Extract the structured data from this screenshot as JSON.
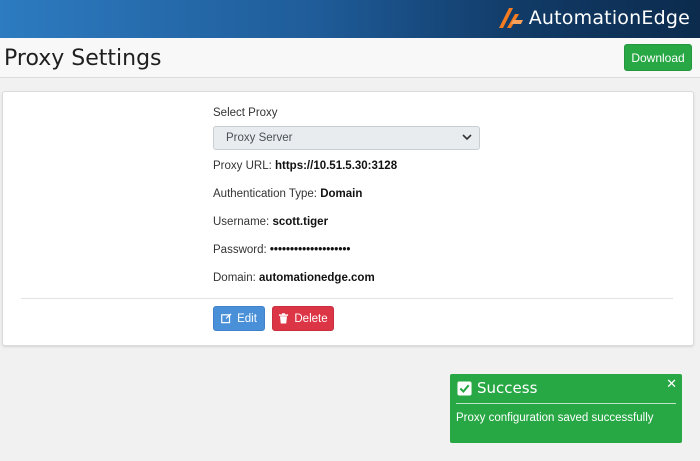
{
  "header": {
    "brand_name": "AutomationEdge",
    "logo_icon": "automationedge-logo-icon",
    "logo_color": "#f47b20"
  },
  "page": {
    "title": "Proxy Settings",
    "download_label": "Download"
  },
  "form": {
    "select_label": "Select Proxy",
    "selected_proxy": "Proxy Server",
    "proxy_url_label": "Proxy URL:",
    "proxy_url_value": "https://10.51.5.30:3128",
    "auth_type_label": "Authentication Type:",
    "auth_type_value": "Domain",
    "username_label": "Username:",
    "username_value": "scott.tiger",
    "password_label": "Password:",
    "password_value": "••••••••••••••••••••",
    "domain_label": "Domain:",
    "domain_value": "automationedge.com"
  },
  "actions": {
    "edit_label": "Edit",
    "delete_label": "Delete"
  },
  "toast": {
    "title": "Success",
    "message": "Proxy configuration saved successfully",
    "close_symbol": "✕",
    "color": "#28a745"
  },
  "colors": {
    "primary": "#4a90d9",
    "danger": "#dc3545",
    "success": "#28a745"
  }
}
